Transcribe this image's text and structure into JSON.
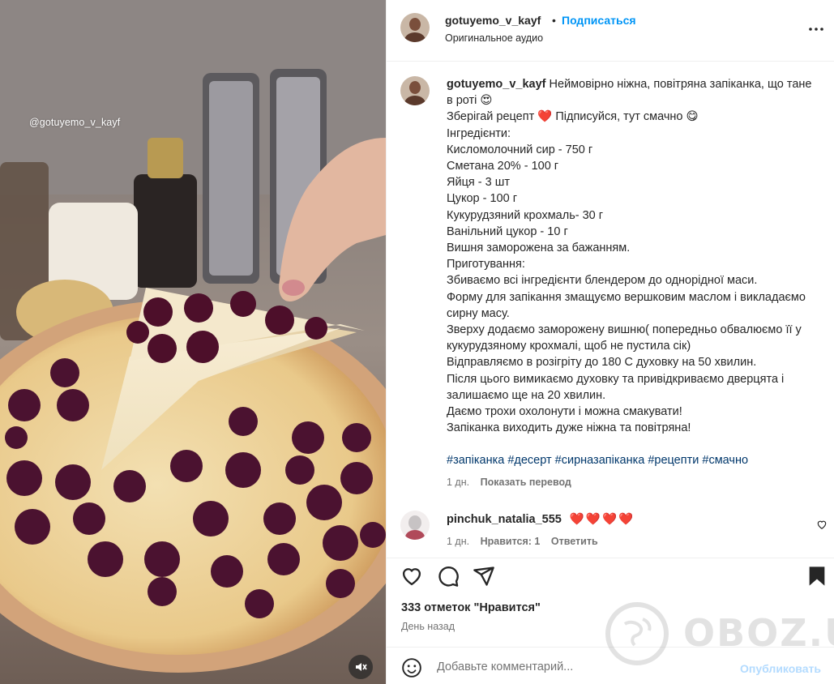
{
  "post": {
    "username": "gotuyemo_v_kayf",
    "separator": "•",
    "follow_label": "Подписаться",
    "audio_label": "Оригинальное аудио",
    "video_watermark": "@gotuyemo_v_kayf"
  },
  "caption": {
    "username": "gotuyemo_v_kayf",
    "lines": [
      "Неймовірно ніжна, повітряна запіканка, що тане в роті 😍",
      "Зберігай рецепт ❤️ Підписуйся, тут смачно 😋",
      "Інгредієнти:",
      "Кисломолочний сир - 750 г",
      "Сметана 20% - 100 г",
      "Яйця - 3 шт",
      "Цукор - 100 г",
      "Кукурудзяний крохмаль- 30 г",
      "Ванільний цукор - 10 г",
      "Вишня заморожена за бажанням.",
      "Приготування:",
      "Збиваємо всі інгредієнти блендером до однорідної маси.",
      "Форму для запікання змащуємо вершковим маслом і викладаємо сирну масу.",
      "Зверху додаємо заморожену вишню( попередньо обвалюємо її у кукурудзяному крохмалі, щоб не пустила сік)",
      "Відправляємо в розігріту до 180 С духовку на 50 хвилин.",
      "Після цього вимикаємо духовку та привідкриваємо дверцята і залишаємо ще на 20 хвилин.",
      "Даємо трохи охолонути і можна смакувати!",
      "Запіканка виходить дуже ніжна та повітряна!"
    ],
    "hashtags": [
      "#запіканка",
      "#десерт",
      "#сирназапіканка",
      "#рецепти",
      "#смачно"
    ],
    "time": "1 дн.",
    "translate_label": "Показать перевод"
  },
  "comment": {
    "username": "pinchuk_natalia_555",
    "text": "❤️❤️❤️❤️",
    "time": "1 дн.",
    "likes": "Нравится: 1",
    "reply_label": "Ответить"
  },
  "stats": {
    "likes_text": "333 отметок \"Нравится\"",
    "posted": "День назад"
  },
  "add_comment": {
    "placeholder": "Добавьте комментарий...",
    "publish_label": "Опубликовать"
  },
  "watermark": {
    "text": "OBOZ.UA"
  },
  "icons": {
    "more": "more-horizontal-icon",
    "heart": "heart-icon",
    "comment": "comment-icon",
    "share": "share-icon",
    "save": "bookmark-icon",
    "emoji": "emoji-icon",
    "mute": "muted-speaker-icon"
  },
  "colors": {
    "link": "#0095f6",
    "hashtag": "#00376b",
    "secondary": "#737373",
    "publish_disabled": "#b3dbff"
  }
}
